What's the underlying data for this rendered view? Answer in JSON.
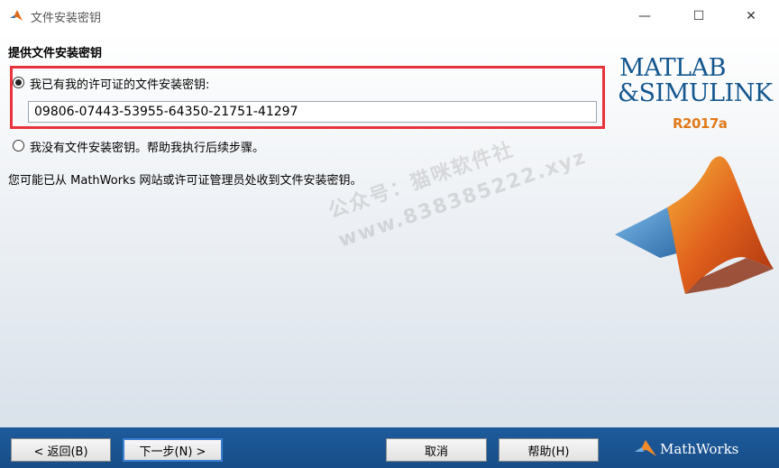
{
  "window": {
    "title": "文件安装密钥",
    "minimize_glyph": "—",
    "maximize_glyph": "☐",
    "close_glyph": "✕"
  },
  "main": {
    "heading": "提供文件安装密钥",
    "option_have_key": "我已有我的许可证的文件安装密钥:",
    "key_value": "09806-07443-53955-64350-21751-41297",
    "option_no_key": "我没有文件安装密钥。帮助我执行后续步骤。",
    "info": "您可能已从 MathWorks 网站或许可证管理员处收到文件安装密钥。",
    "watermark_line1": "公众号：猫咪软件社",
    "watermark_line2": "www.838385222.xyz"
  },
  "branding": {
    "logo_line1": "MATLAB",
    "logo_line2": "&SIMULINK",
    "release": "R2017a",
    "vendor": "MathWorks"
  },
  "footer": {
    "back_label": "< 返回(B)",
    "next_label": "下一步(N) >",
    "cancel_label": "取消",
    "help_label": "帮助(H)"
  },
  "colors": {
    "highlight": "#e8323c",
    "footer": "#1d5b9c",
    "logo_blue": "#14578f",
    "release_orange": "#e07a1a"
  },
  "icons": [
    "matlab-icon",
    "minimize-icon",
    "maximize-icon",
    "close-icon",
    "membrane-logo-icon",
    "mathworks-logo-icon"
  ]
}
